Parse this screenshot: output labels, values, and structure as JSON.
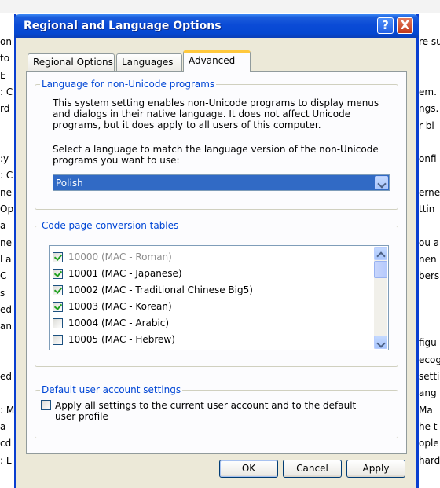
{
  "background_window": {
    "left_fragments": [
      "on",
      "to",
      "E",
      ": C",
      "rd",
      "",
      "",
      ":y",
      ": C",
      "ne",
      "Op",
      " a",
      "ne",
      "l a",
      "C",
      "s",
      "ed",
      "an",
      "",
      "",
      "ed",
      "",
      ": M",
      " a",
      "cd",
      ": L"
    ],
    "right_fragments": [
      "re su",
      "",
      "",
      "em.",
      "ngs.",
      "r bl",
      "",
      "onfi",
      "",
      "erne",
      "ttin",
      "",
      "ou a",
      "nen",
      "bers",
      "",
      "",
      "",
      "figu",
      "ecog",
      "setti",
      "ang",
      " Ma",
      "he t",
      "ople",
      "hard"
    ]
  },
  "dialog": {
    "title": "Regional and Language Options",
    "help_icon": "?",
    "close_icon": "X",
    "tabs": [
      {
        "label": "Regional Options"
      },
      {
        "label": "Languages"
      },
      {
        "label": "Advanced"
      }
    ],
    "active_tab": "Advanced",
    "non_unicode": {
      "legend": "Language for non-Unicode programs",
      "description": "This system setting enables non-Unicode programs to display menus and dialogs in their native language. It does not affect Unicode programs, but it does apply to all users of this computer.",
      "prompt": "Select a language to match the language version of the non-Unicode programs you want to use:",
      "selected_language": "Polish"
    },
    "code_pages": {
      "legend": "Code page conversion tables",
      "items": [
        {
          "label": "10000 (MAC - Roman)",
          "checked": true,
          "disabled": true
        },
        {
          "label": "10001 (MAC - Japanese)",
          "checked": true,
          "disabled": false
        },
        {
          "label": "10002 (MAC - Traditional Chinese Big5)",
          "checked": true,
          "disabled": false
        },
        {
          "label": "10003 (MAC - Korean)",
          "checked": true,
          "disabled": false
        },
        {
          "label": "10004 (MAC - Arabic)",
          "checked": false,
          "disabled": false
        },
        {
          "label": "10005 (MAC - Hebrew)",
          "checked": false,
          "disabled": false
        }
      ]
    },
    "default_user": {
      "legend": "Default user account settings",
      "checkbox_label_line1": "Apply all settings to the current user account and to the default",
      "checkbox_label_line2": "user profile",
      "checked": false
    },
    "buttons": {
      "ok": "OK",
      "cancel": "Cancel",
      "apply": "Apply"
    }
  }
}
